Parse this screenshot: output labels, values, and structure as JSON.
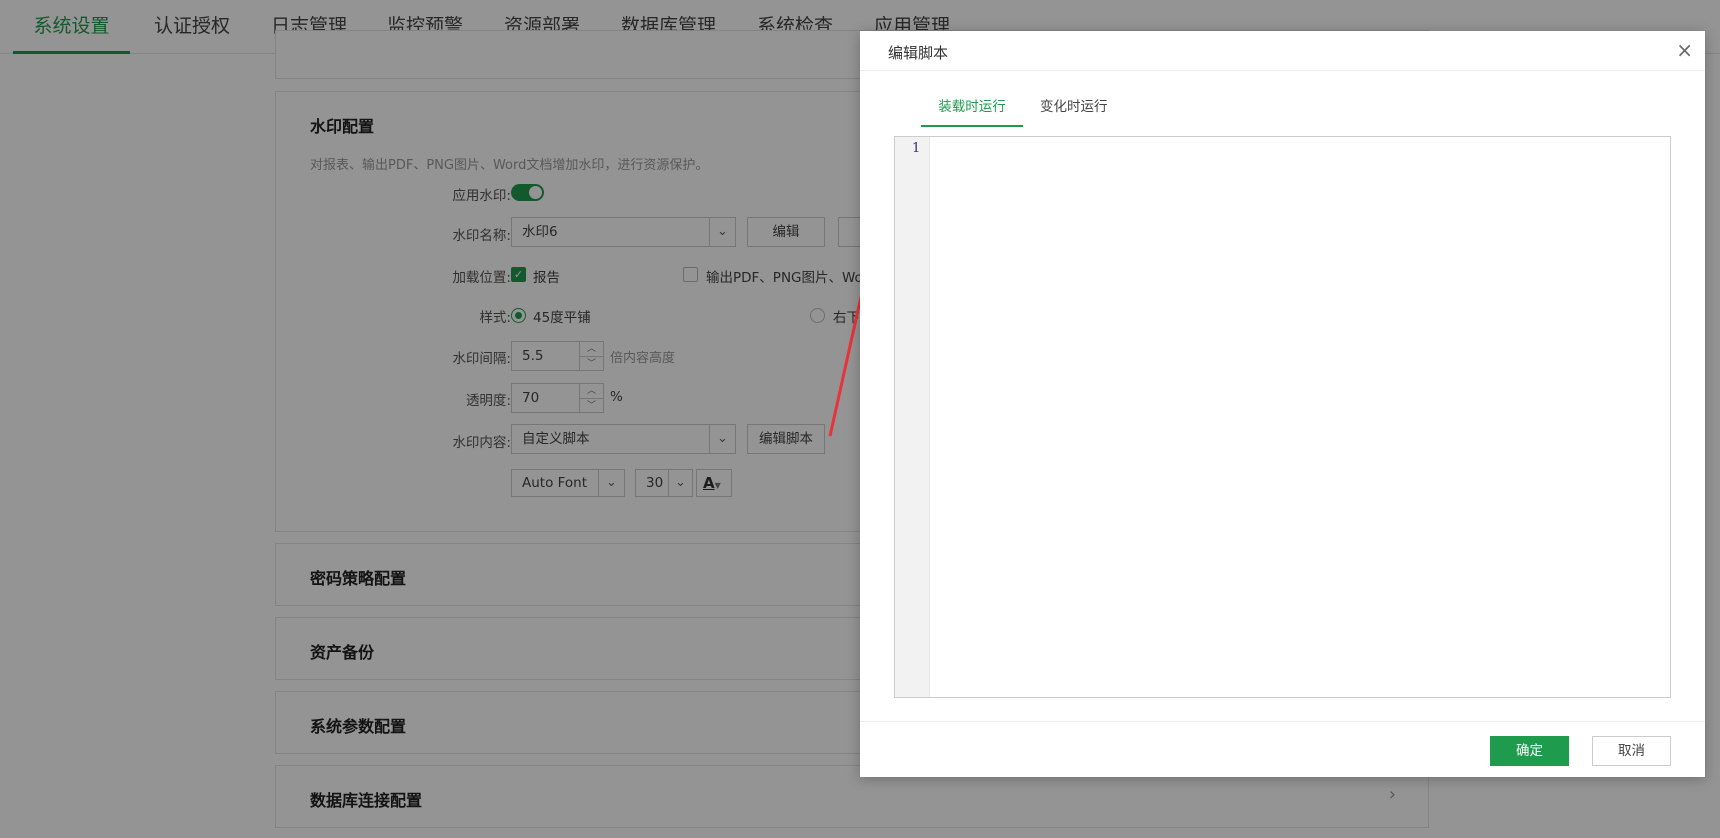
{
  "nav": {
    "tabs": [
      {
        "label": "系统设置",
        "active": true
      },
      {
        "label": "认证授权"
      },
      {
        "label": "日志管理"
      },
      {
        "label": "监控预警"
      },
      {
        "label": "资源部署"
      },
      {
        "label": "数据库管理"
      },
      {
        "label": "系统检查"
      },
      {
        "label": "应用管理"
      }
    ]
  },
  "watermark": {
    "title": "水印配置",
    "description": "对报表、输出PDF、PNG图片、Word文档增加水印，进行资源保护。",
    "apply_label": "应用水印:",
    "apply_enabled": true,
    "name_label": "水印名称:",
    "name_value": "水印6",
    "edit_button": "编辑",
    "load_label": "加载位置:",
    "load_report": "报告",
    "load_report_checked": true,
    "load_export": "输出PDF、PNG图片、Wor",
    "load_export_checked": false,
    "style_label": "样式:",
    "style_option1": "45度平铺",
    "style_option2": "右下",
    "interval_label": "水印间隔:",
    "interval_value": "5.5",
    "interval_unit": "倍内容高度",
    "opacity_label": "透明度:",
    "opacity_value": "70",
    "opacity_unit": "%",
    "content_label": "水印内容:",
    "content_value": "自定义脚本",
    "edit_script_button": "编辑脚本",
    "font_value": "Auto Font",
    "font_size_value": "30",
    "font_color_glyph": "A"
  },
  "sections": {
    "password_policy": "密码策略配置",
    "asset_backup": "资产备份",
    "system_params": "系统参数配置",
    "db_connection": "数据库连接配置"
  },
  "dialog": {
    "title": "编辑脚本",
    "close_glyph": "×",
    "tab_load": "装载时运行",
    "tab_change": "变化时运行",
    "line_number": "1",
    "ok_button": "确定",
    "cancel_button": "取消"
  },
  "colors": {
    "accent": "#1f9b4e",
    "annotation_arrow": "#e8333b"
  }
}
